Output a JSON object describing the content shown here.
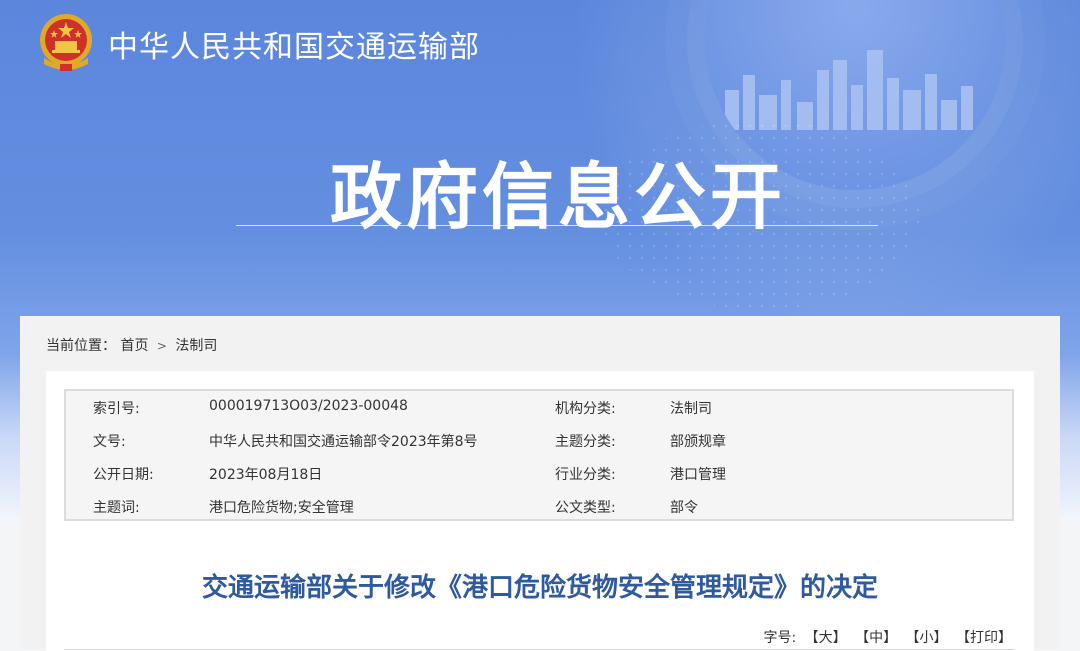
{
  "header": {
    "ministry_title": "中华人民共和国交通运输部",
    "section_title": "政府信息公开"
  },
  "breadcrumb": {
    "prefix": "当前位置：",
    "items": [
      "首页",
      "法制司"
    ],
    "separator": ">"
  },
  "info": {
    "rows": [
      {
        "label1": "索引号:",
        "value1": "000019713O03/2023-00048",
        "label2": "机构分类:",
        "value2": "法制司"
      },
      {
        "label1": "文号:",
        "value1": "中华人民共和国交通运输部令2023年第8号",
        "label2": "主题分类:",
        "value2": "部颁规章"
      },
      {
        "label1": "公开日期:",
        "value1": "2023年08月18日",
        "label2": "行业分类:",
        "value2": "港口管理"
      },
      {
        "label1": "主题词:",
        "value1": "港口危险货物;安全管理",
        "label2": "公文类型:",
        "value2": "部令"
      }
    ]
  },
  "document": {
    "title": "交通运输部关于修改《港口危险货物安全管理规定》的决定"
  },
  "font_size": {
    "label": "字号:",
    "large": "【大】",
    "medium": "【中】",
    "small": "【小】",
    "print": "【打印】"
  },
  "colors": {
    "header_blue": "#5b86dc",
    "title_blue": "#2f5a9e"
  }
}
